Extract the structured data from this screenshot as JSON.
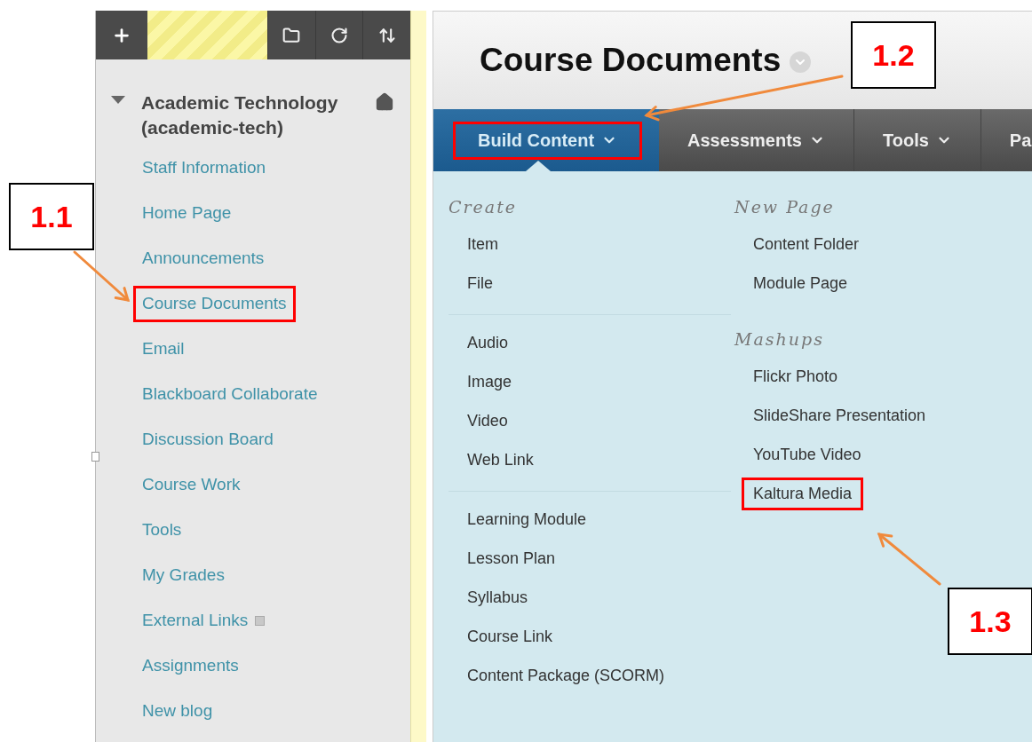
{
  "sidebar": {
    "course": {
      "title": "Academic Technology (academic-tech)",
      "expanded": true
    },
    "items": [
      {
        "label": "Staff Information",
        "highlighted": false
      },
      {
        "label": "Home Page",
        "highlighted": false
      },
      {
        "label": "Announcements",
        "highlighted": false
      },
      {
        "label": "Course Documents",
        "highlighted": true
      },
      {
        "label": "Email",
        "highlighted": false
      },
      {
        "label": "Blackboard Collaborate",
        "highlighted": false
      },
      {
        "label": "Discussion Board",
        "highlighted": false
      },
      {
        "label": "Course Work",
        "highlighted": false
      },
      {
        "label": "Tools",
        "highlighted": false
      },
      {
        "label": "My Grades",
        "highlighted": false
      },
      {
        "label": "External Links",
        "highlighted": false,
        "kind": "external"
      },
      {
        "label": "Assignments",
        "highlighted": false
      },
      {
        "label": "New blog",
        "highlighted": false
      }
    ]
  },
  "page": {
    "title": "Course Documents"
  },
  "tabs": [
    {
      "label": "Build Content",
      "selected": true,
      "highlighted": true
    },
    {
      "label": "Assessments",
      "selected": false,
      "highlighted": false
    },
    {
      "label": "Tools",
      "selected": false,
      "highlighted": false
    },
    {
      "label": "Pa",
      "selected": false,
      "highlighted": false
    }
  ],
  "menu": {
    "columns": [
      {
        "sections": [
          {
            "heading": "Create",
            "items": [
              {
                "label": "Item",
                "highlighted": false
              },
              {
                "label": "File",
                "highlighted": false
              }
            ]
          },
          {
            "items": [
              {
                "label": "Audio",
                "highlighted": false
              },
              {
                "label": "Image",
                "highlighted": false
              },
              {
                "label": "Video",
                "highlighted": false
              },
              {
                "label": "Web Link",
                "highlighted": false
              }
            ]
          },
          {
            "items": [
              {
                "label": "Learning Module",
                "highlighted": false
              },
              {
                "label": "Lesson Plan",
                "highlighted": false
              },
              {
                "label": "Syllabus",
                "highlighted": false
              },
              {
                "label": "Course Link",
                "highlighted": false
              },
              {
                "label": "Content Package (SCORM)",
                "highlighted": false
              }
            ]
          }
        ]
      },
      {
        "sections": [
          {
            "heading": "New Page",
            "items": [
              {
                "label": "Content Folder",
                "highlighted": false
              },
              {
                "label": "Module Page",
                "highlighted": false
              }
            ]
          },
          {
            "heading": "Mashups",
            "items": [
              {
                "label": "Flickr Photo",
                "highlighted": false
              },
              {
                "label": "SlideShare Presentation",
                "highlighted": false
              },
              {
                "label": "YouTube Video",
                "highlighted": false
              },
              {
                "label": "Kaltura Media",
                "highlighted": true
              }
            ]
          }
        ]
      }
    ]
  },
  "annotations": [
    {
      "label": "1.1"
    },
    {
      "label": "1.2"
    },
    {
      "label": "1.3"
    }
  ]
}
